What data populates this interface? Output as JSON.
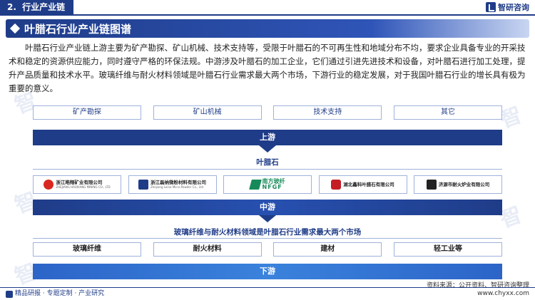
{
  "header": {
    "section_number": "2.",
    "section_title": "行业产业链",
    "brand": "智研咨询"
  },
  "title": "叶腊石行业产业链图谱",
  "paragraph": "叶腊石行业产业链上游主要为矿产勘探、矿山机械、技术支持等，受限于叶腊石的不可再生性和地域分布不均，要求企业具备专业的开采技术和稳定的资源供应能力，同时遵守严格的环保法规。中游涉及叶腊石的加工企业，它们通过引进先进技术和设备，对叶腊石进行加工处理，提升产品质量和技术水平。玻璃纤维与耐火材料领域是叶腊石行业需求最大两个市场，下游行业的稳定发展，对于我国叶腊石行业的增长具有极为重要的意义。",
  "upstream": {
    "items": [
      "矿产勘探",
      "矿山机械",
      "技术支持",
      "其它"
    ],
    "label": "上游"
  },
  "midstream": {
    "product": "叶腊石",
    "label": "中游",
    "companies": [
      {
        "name": "浙江皓翔矿业有限公司",
        "en": "ZHEJIANG HAOXIANG MINING CO., LTD",
        "color": "red"
      },
      {
        "name": "浙江磊纳微粉材料有限公司",
        "en": "Zhejiang Leina Micro Powder Co., Ltd",
        "color": "blue"
      },
      {
        "name": "南方玻纤",
        "en": "NFGF",
        "color": "green"
      },
      {
        "name": "湖北鑫科叶腊石有限公司",
        "en": "",
        "color": "sq"
      },
      {
        "name": "济源市耐火炉业有限公司",
        "en": "",
        "color": "black"
      }
    ]
  },
  "downstream": {
    "heading": "玻璃纤维与耐火材料领域是叶腊石行业需求最大两个市场",
    "items": [
      "玻璃纤维",
      "耐火材料",
      "建材",
      "轻工业等"
    ],
    "label": "下游"
  },
  "footer": {
    "source": "资料来源：公开资料、智研咨询整理",
    "left_text": "精品研报 · 专题定制 · 产业研究",
    "right_text": "www.chyxx.com"
  }
}
